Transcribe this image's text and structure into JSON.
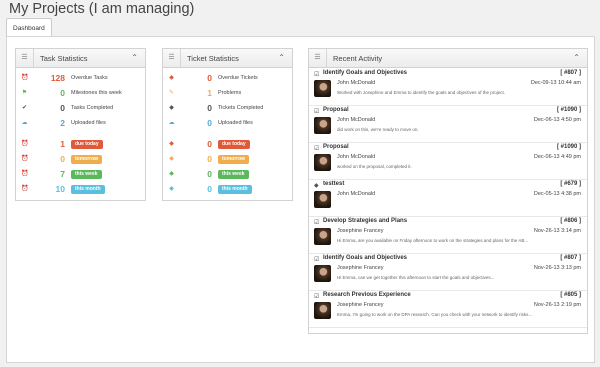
{
  "page": {
    "title": "My Projects (I am managing)"
  },
  "tabs": [
    {
      "label": "Dashboard"
    }
  ],
  "task_stats": {
    "title": "Task Statistics",
    "rows": [
      {
        "icon": "alarm-icon",
        "value": "128",
        "label": "Overdue Tasks",
        "color": "#e05a3a"
      },
      {
        "icon": "flag-icon",
        "value": "0",
        "label": "Milestones this week",
        "color": "#5cb85c"
      },
      {
        "icon": "check-icon",
        "value": "0",
        "label": "Tasks Completed",
        "color": "#555555"
      },
      {
        "icon": "upload-icon",
        "value": "2",
        "label": "Uploaded files",
        "color": "#5aa6d6"
      }
    ],
    "badges": [
      {
        "value": "1",
        "label": "due today",
        "color": "#e05a3a"
      },
      {
        "value": "0",
        "label": "tomorrow",
        "color": "#f0ad4e"
      },
      {
        "value": "7",
        "label": "this week",
        "color": "#5cb85c"
      },
      {
        "value": "10",
        "label": "this month",
        "color": "#5bc0de"
      }
    ]
  },
  "ticket_stats": {
    "title": "Ticket Statistics",
    "rows": [
      {
        "icon": "tag-icon",
        "value": "0",
        "label": "Overdue Tickets",
        "color": "#e05a3a"
      },
      {
        "icon": "pencil-icon",
        "value": "1",
        "label": "Problems",
        "color": "#f0ad4e"
      },
      {
        "icon": "tag-icon",
        "value": "0",
        "label": "Tickets Completed",
        "color": "#555555"
      },
      {
        "icon": "upload-icon",
        "value": "0",
        "label": "Uploaded files",
        "color": "#5aa6d6"
      }
    ],
    "badges": [
      {
        "value": "0",
        "label": "due today",
        "color": "#e05a3a"
      },
      {
        "value": "0",
        "label": "tomorrow",
        "color": "#f0ad4e"
      },
      {
        "value": "0",
        "label": "this week",
        "color": "#5cb85c"
      },
      {
        "value": "0",
        "label": "this month",
        "color": "#5bc0de"
      }
    ]
  },
  "activity": {
    "title": "Recent Activity",
    "items": [
      {
        "icon": "checkbox-icon",
        "title": "Identify Goals and Objectives",
        "id": "[ #807 ]",
        "user": "John McDonald",
        "time": "Dec-09-13 10:44 am",
        "message": "Worked with Josephine and Emma to identify the goals and objectives of the project."
      },
      {
        "icon": "checkbox-icon",
        "title": "Proposal",
        "id": "[ #1090 ]",
        "user": "John McDonald",
        "time": "Dec-06-13 4:50 pm",
        "message": "did work on this, we're ready to move on."
      },
      {
        "icon": "checkbox-icon",
        "title": "Proposal",
        "id": "[ #1090 ]",
        "user": "John McDonald",
        "time": "Dec-06-13 4:49 pm",
        "message": "worked on the proposal, completed it."
      },
      {
        "icon": "tag-icon",
        "title": "testtest",
        "id": "[ #679 ]",
        "user": "John McDonald",
        "time": "Dec-05-13 4:38 pm",
        "message": ""
      },
      {
        "icon": "checkbox-icon",
        "title": "Develop Strategies and Plans",
        "id": "[ #806 ]",
        "user": "Josephine Francey",
        "time": "Nov-26-13 3:14 pm",
        "message": "Hi Emma, are you available on Friday afternoon to work on the strategies and plans for the AB..."
      },
      {
        "icon": "checkbox-icon",
        "title": "Identify Goals and Objectives",
        "id": "[ #807 ]",
        "user": "Josephine Francey",
        "time": "Nov-26-13 3:13 pm",
        "message": "Hi Emma, can we get together this afternoon to start the goals and objectives..."
      },
      {
        "icon": "checkbox-icon",
        "title": "Research Previous Experience",
        "id": "[ #805 ]",
        "user": "Josephine Francey",
        "time": "Nov-26-13 2:19 pm",
        "message": "Emma, I'm going to work on the DPA research. Can you check with your network to identify risks..."
      }
    ]
  }
}
